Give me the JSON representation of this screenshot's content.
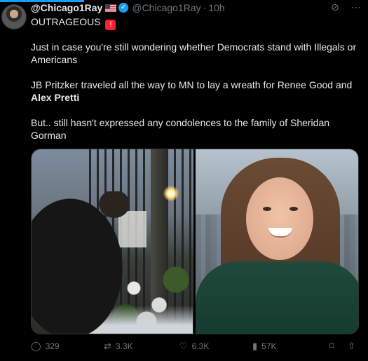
{
  "tweet": {
    "name": "@Chicago1Ray",
    "handle": "@Chicago1Ray",
    "dot": "·",
    "time": "10h",
    "first_line": "OUTRAGEOUS",
    "paragraph1": "Just in case you're still wondering whether Democrats stand with Illegals or Americans",
    "paragraph2_prefix": "JB Pritzker traveled all the way to MN to lay a wreath for Renee Good and",
    "paragraph2_bold": "Alex Pretti",
    "paragraph3": "But.. still hasn't expressed any condolences to the family of Sheridan Gorman"
  },
  "icons": {
    "flag": "us-flag-icon",
    "verified": "verified-badge-icon",
    "siren": "siren-emoji-icon",
    "grok": "grok-icon",
    "more": "more-icon",
    "reply": "reply-icon",
    "retweet": "retweet-icon",
    "like": "like-icon",
    "views": "views-icon",
    "bookmark": "bookmark-icon",
    "share": "share-icon"
  },
  "actions": {
    "replies": "329",
    "retweets": "3.3K",
    "likes": "6.3K",
    "views": "57K"
  },
  "colors": {
    "background": "#000000",
    "text": "#e7e9ea",
    "muted": "#71767b",
    "accent": "#1d9bf0"
  }
}
